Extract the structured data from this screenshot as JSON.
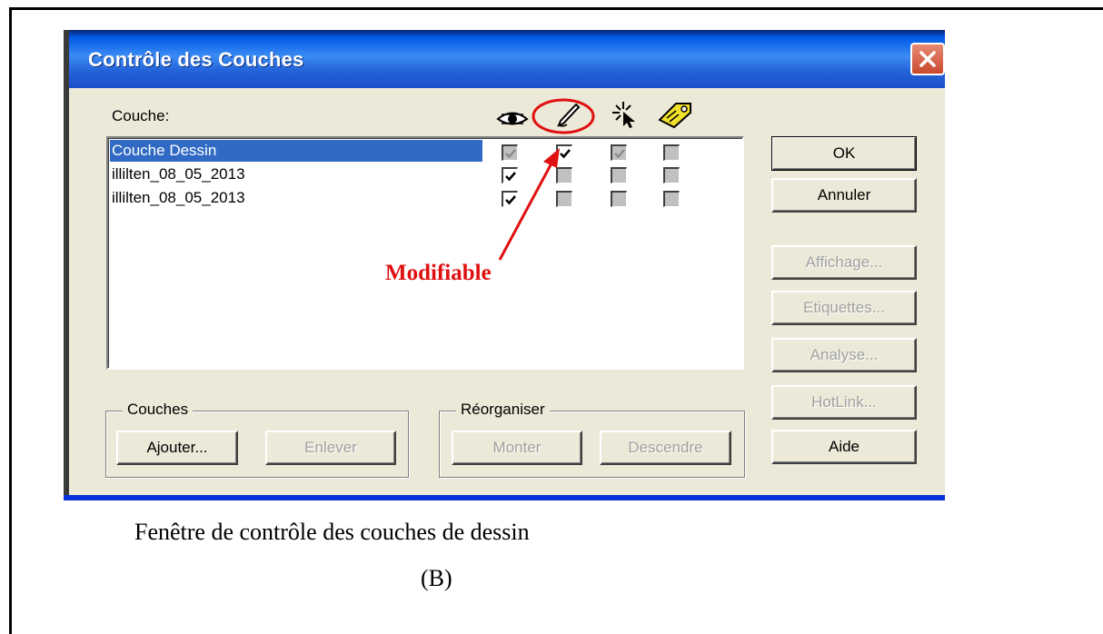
{
  "dialog": {
    "title": "Contrôle des Couches",
    "layer_label": "Couche:",
    "columns": [
      "visible-eye-icon",
      "editable-pencil-icon",
      "selectable-cursor-icon",
      "label-tag-icon"
    ],
    "layers": [
      {
        "name": "Couche Dessin",
        "selected": true,
        "checks": [
          "checked-disabled",
          "checked",
          "checked-disabled",
          "unchecked-disabled"
        ]
      },
      {
        "name": "illilten_08_05_2013",
        "selected": false,
        "checks": [
          "checked",
          "unchecked-disabled",
          "unchecked-disabled",
          "unchecked-disabled"
        ]
      },
      {
        "name": "illilten_08_05_2013",
        "selected": false,
        "checks": [
          "checked",
          "unchecked-disabled",
          "unchecked-disabled",
          "unchecked-disabled"
        ]
      }
    ],
    "buttons": {
      "ok": "OK",
      "cancel": "Annuler",
      "display": "Affichage...",
      "labels": "Etiquettes...",
      "analysis": "Analyse...",
      "hotlink": "HotLink...",
      "help": "Aide"
    },
    "layers_group": {
      "label": "Couches",
      "add": "Ajouter...",
      "remove": "Enlever"
    },
    "reorder_group": {
      "label": "Réorganiser",
      "up": "Monter",
      "down": "Descendre"
    }
  },
  "annotation": {
    "text": "Modifiable",
    "color": "#e01010"
  },
  "caption": {
    "line1": "Fenêtre de contrôle des couches de dessin",
    "line2": "(B)"
  },
  "colors": {
    "titlebar": "#0058e6",
    "selection": "#316ac5",
    "dialog_bg": "#ece9d8"
  }
}
